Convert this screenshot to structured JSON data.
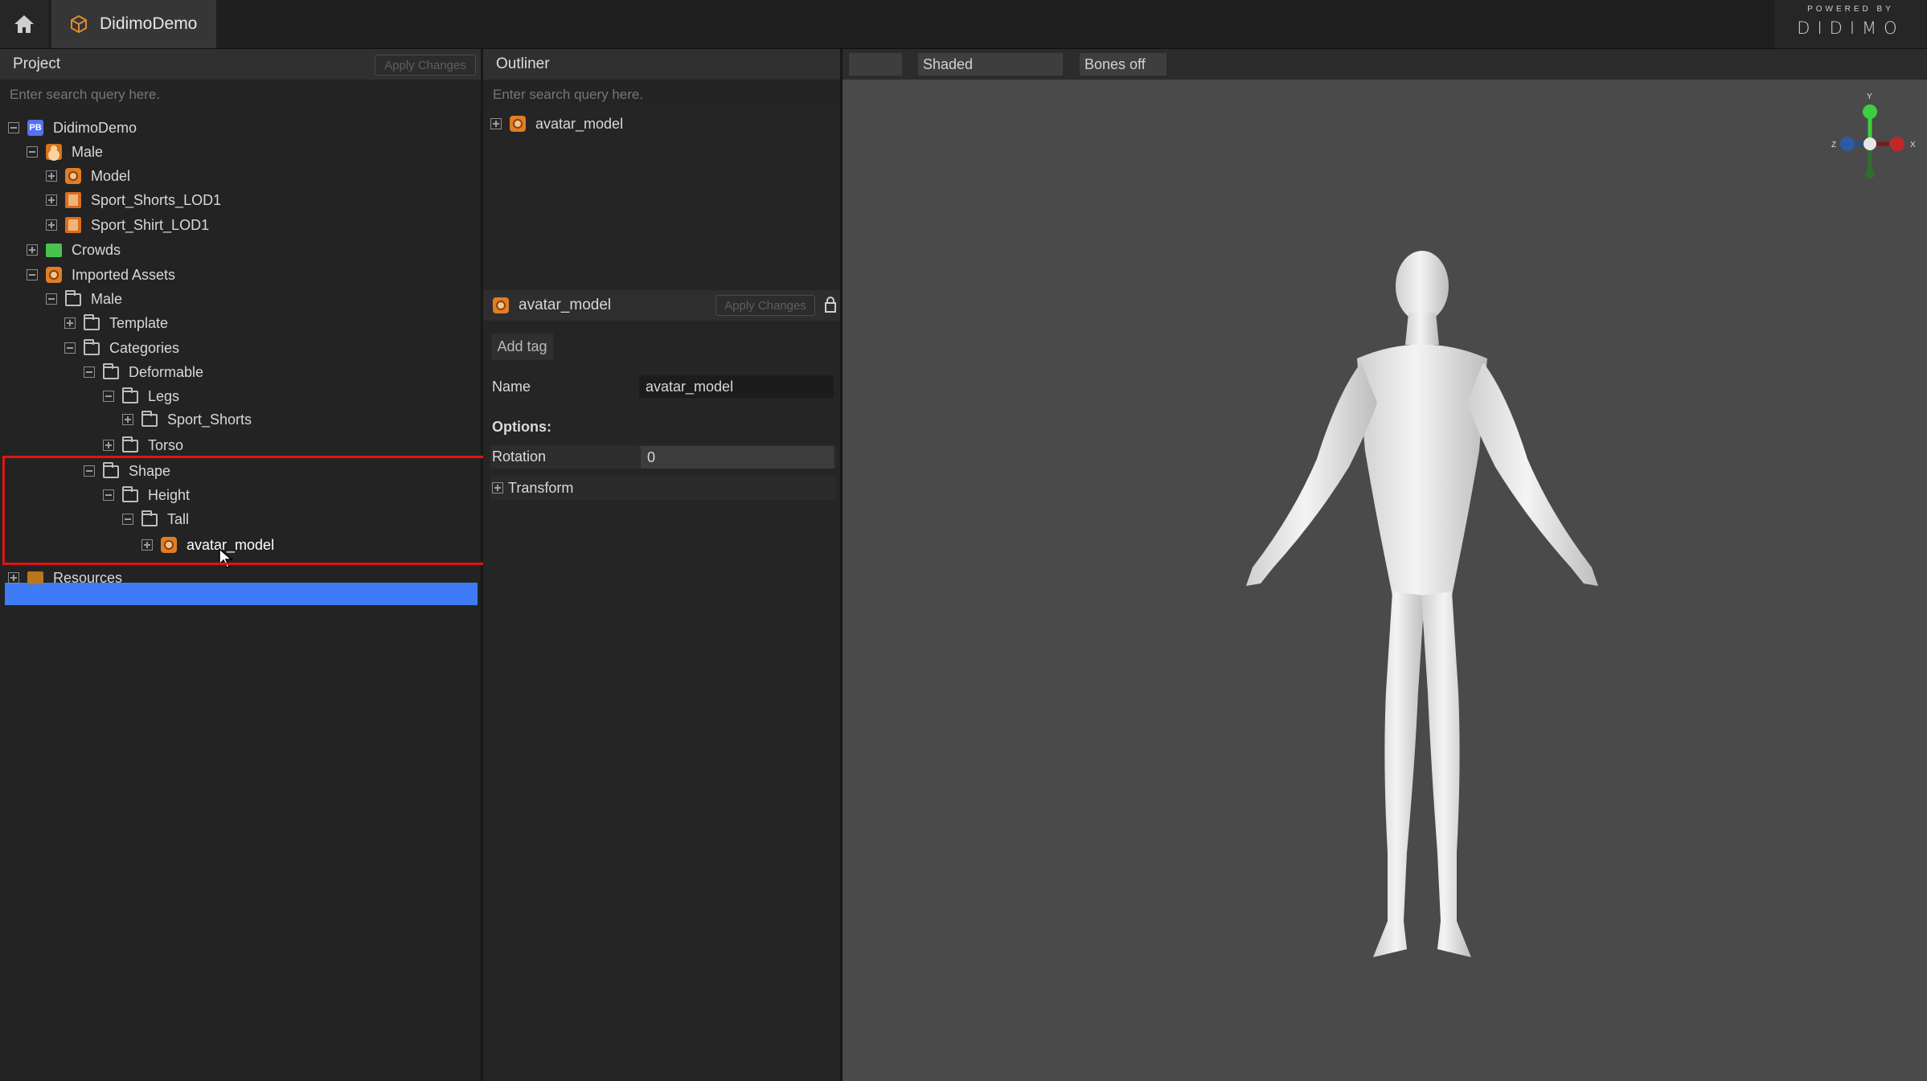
{
  "topbar": {
    "tab_title": "DidimoDemo",
    "brand_small": "POWERED BY",
    "brand_big": "DIDIMO"
  },
  "project": {
    "title": "Project",
    "apply_label": "Apply Changes",
    "search_placeholder": "Enter search query here.",
    "tree": {
      "root": "DidimoDemo",
      "male": "Male",
      "model": "Model",
      "shorts_lod": "Sport_Shorts_LOD1",
      "shirt_lod": "Sport_Shirt_LOD1",
      "crowds": "Crowds",
      "imported": "Imported Assets",
      "imp_male": "Male",
      "template": "Template",
      "categories": "Categories",
      "deformable": "Deformable",
      "legs": "Legs",
      "sport_shorts": "Sport_Shorts",
      "torso": "Torso",
      "shape": "Shape",
      "height": "Height",
      "tall": "Tall",
      "avatar_model": "avatar_model",
      "resources": "Resources"
    }
  },
  "outliner": {
    "title": "Outliner",
    "search_placeholder": "Enter search query here.",
    "item": "avatar_model"
  },
  "inspector": {
    "title": "avatar_model",
    "apply_label": "Apply Changes",
    "add_tag": "Add tag",
    "name_label": "Name",
    "name_value": "avatar_model",
    "options_label": "Options:",
    "rotation_label": "Rotation",
    "rotation_value": "0",
    "transform_label": "Transform"
  },
  "viewport": {
    "shading_mode": "Shaded",
    "bones_mode": "Bones off",
    "gizmo": {
      "y": "Y",
      "x": "X",
      "z": "Z"
    }
  },
  "colors": {
    "selection": "#3e7bf5",
    "highlight_box": "#e01515",
    "accent_orange": "#e07d26"
  }
}
